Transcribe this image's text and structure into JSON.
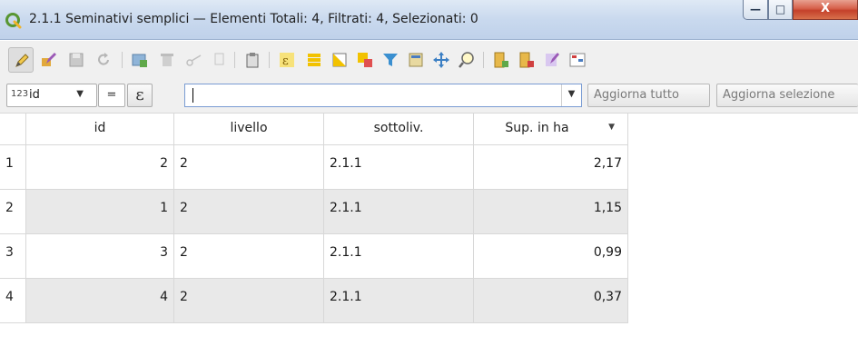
{
  "window": {
    "title": "2.1.1 Seminativi semplici — Elementi Totali: 4,  Filtrati: 4, Selezionati: 0",
    "minimize_glyph": "—",
    "maximize_glyph": "□",
    "close_glyph": "X"
  },
  "toolbar": {
    "buttons": [
      "toggle-editing-icon",
      "multi-edit-icon",
      "save-edits-icon",
      "reload-icon",
      "add-feature-icon",
      "delete-features-icon",
      "cut-icon",
      "copy-icon",
      "paste-icon",
      "select-by-expression-icon",
      "select-all-icon",
      "invert-selection-icon",
      "deselect-all-icon",
      "filter-selected-icon",
      "move-selection-top-icon",
      "pan-to-selected-icon",
      "zoom-to-selected-icon",
      "new-field-icon",
      "delete-field-icon",
      "field-calculator-icon",
      "conditional-formatting-icon"
    ]
  },
  "filter": {
    "field_type": "123",
    "field_name": "id",
    "operator": "=",
    "expression_glyph": "ε",
    "value": "",
    "update_all_label": "Aggiorna tutto",
    "update_selected_label": "Aggiorna selezione"
  },
  "table": {
    "columns": [
      "id",
      "livello",
      "sottoliv.",
      "Sup. in ha"
    ],
    "sort_indicator": "▼",
    "rows": [
      {
        "row": "1",
        "id": "2",
        "livello": "2",
        "sottoliv": "2.1.1",
        "sup": "2,17"
      },
      {
        "row": "2",
        "id": "1",
        "livello": "2",
        "sottoliv": "2.1.1",
        "sup": "1,15"
      },
      {
        "row": "3",
        "id": "3",
        "livello": "2",
        "sottoliv": "2.1.1",
        "sup": "0,99"
      },
      {
        "row": "4",
        "id": "4",
        "livello": "2",
        "sottoliv": "2.1.1",
        "sup": "0,37"
      }
    ]
  },
  "colors": {
    "titlebar": "#c9d9ee",
    "close_button": "#c4402a",
    "alt_row": "#e9e9e9",
    "qgis_green": "#589632"
  }
}
